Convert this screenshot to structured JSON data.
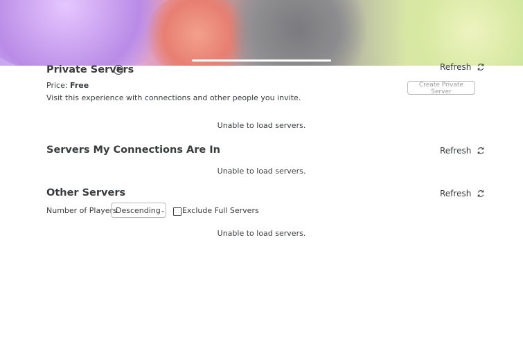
{
  "banner": {
    "image_icon": "game-thumbnail-art"
  },
  "private_servers": {
    "title": "Private Servers",
    "help_icon": "question-circle-icon",
    "refresh_label": "Refresh",
    "price_label": "Price:",
    "price_value": "Free",
    "description": "Visit this experience with connections and other people you invite.",
    "create_button_label": "Create Private Server",
    "empty_message": "Unable to load servers."
  },
  "connections_servers": {
    "title": "Servers My Connections Are In",
    "refresh_label": "Refresh",
    "empty_message": "Unable to load servers."
  },
  "other_servers": {
    "title": "Other Servers",
    "refresh_label": "Refresh",
    "sort_label": "Number of Players",
    "sort_selected": "Descending",
    "exclude_full_label": "Exclude Full Servers",
    "exclude_full_checked": false,
    "empty_message": "Unable to load servers."
  },
  "icons": {
    "refresh": "refresh-icon",
    "dropdown": "chevron-down-icon"
  },
  "colors": {
    "text": "#393b3d",
    "muted_button_text": "#9a9a9a",
    "border": "#b8b8b8"
  }
}
